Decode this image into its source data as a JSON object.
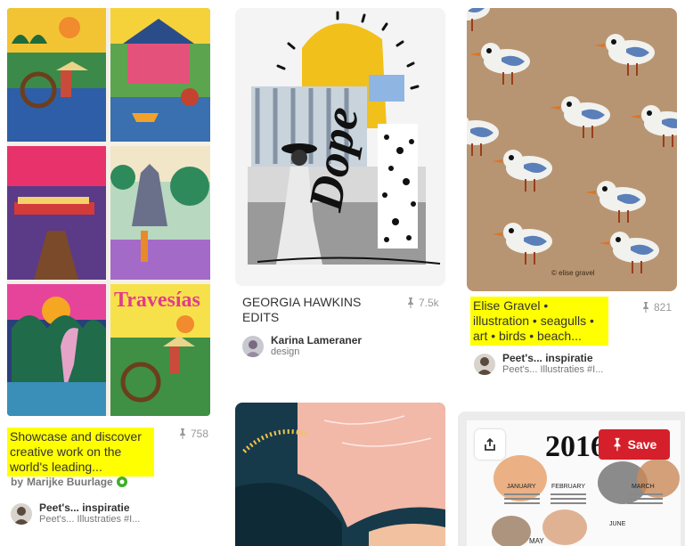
{
  "pins": [
    {
      "caption": "Showcase and discover creative work on the world's leading...",
      "saves": "758",
      "attribution_prefix": "by",
      "attribution_name": "Marijke Buurlage",
      "board_title": "Peet's... inspiratie",
      "board_sub": "Peet's... Illustraties #I...",
      "cover_title": "Travesías"
    },
    {
      "caption": "GEORGIA HAWKINS EDITS",
      "saves": "7.5k",
      "user_name": "Karina Lameraner",
      "board_sub": "design",
      "art_word": "Dope"
    },
    {
      "caption": "Elise Gravel • illustration • seagulls • art • birds • beach...",
      "saves": "821",
      "board_title": "Peet's... inspiratie",
      "board_sub": "Peet's... Illustraties #I...",
      "signature": "© elise gravel"
    },
    {
      "calendar_year": "2016",
      "calendar_months": [
        "JANUARY",
        "FEBRUARY",
        "MARCH",
        "MAY",
        "JUNE"
      ],
      "save_label": "Save"
    }
  ],
  "colors": {
    "highlight": "#ffff00",
    "save_button": "#d5202b"
  },
  "icons": {
    "pin": "pushpin-icon",
    "share": "share-icon",
    "verified": "verified-icon"
  }
}
